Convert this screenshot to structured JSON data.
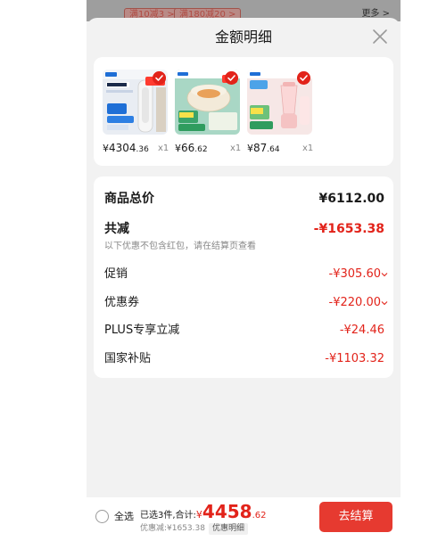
{
  "background_banner": {
    "tags": [
      "满10减3 >",
      "满180减20 >"
    ],
    "more": "更多 >"
  },
  "sheet": {
    "title": "金额明细",
    "close_icon": "close-icon"
  },
  "products": [
    {
      "currency": "¥",
      "integer": "4304",
      "decimal": ".36",
      "qty": "x1",
      "thumb_icon": "tower-fan-product-image"
    },
    {
      "currency": "¥",
      "integer": "66",
      "decimal": ".62",
      "qty": "x1",
      "thumb_icon": "electric-cooker-product-image"
    },
    {
      "currency": "¥",
      "integer": "87",
      "decimal": ".64",
      "qty": "x1",
      "thumb_icon": "blender-product-image"
    }
  ],
  "details": {
    "total_label": "商品总价",
    "total_value": "¥6112.00",
    "reduce_label": "共减",
    "reduce_value": "-¥1653.38",
    "reduce_note": "以下优惠不包含红包，请在结算页查看",
    "promo_label": "促销",
    "promo_value": "-¥305.60",
    "coupon_label": "优惠券",
    "coupon_value": "-¥220.00",
    "plus_label": "PLUS专享立减",
    "plus_value": "-¥24.46",
    "subsidy_label": "国家补贴",
    "subsidy_value": "-¥1103.32"
  },
  "bottom_bar": {
    "select_all": "全选",
    "selected_text": "已选3件,合计:",
    "total_currency": "¥",
    "total_integer": "4458",
    "total_decimal": ".62",
    "discount_text": "优惠减:¥1653.38",
    "detail_tag": "优惠明细",
    "checkout_label": "去结算"
  },
  "colors": {
    "accent_red": "#e2231a",
    "checkout_button": "#e63a30",
    "sheet_bg": "#f2f2f2"
  }
}
